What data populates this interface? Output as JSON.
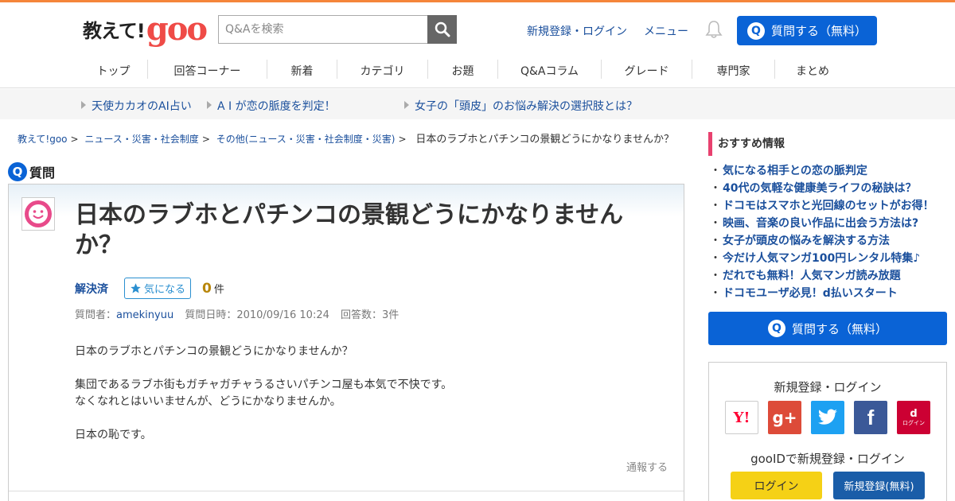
{
  "header": {
    "logo_text": "教えて!",
    "logo_brand": "goo",
    "search_placeholder": "Q&Aを検索",
    "register_login": "新規登録・ログイン",
    "menu": "メニュー",
    "ask_button": "質問する（無料）"
  },
  "nav": [
    "トップ",
    "回答コーナー",
    "新着",
    "カテゴリ",
    "お題",
    "Q&Aコラム",
    "グレード",
    "専門家",
    "まとめ"
  ],
  "promo": [
    "天使カカオのAI占い",
    "A I が恋の脈度を判定！",
    "女子の「頭皮」のお悩み解決の選択肢とは？"
  ],
  "breadcrumb": {
    "items": [
      "教えて!goo",
      "ニュース・災害・社会制度",
      "その他(ニュース・災害・社会制度・災害)"
    ],
    "separator": ">",
    "current": "日本のラブホとパチンコの景観どうにかなりませんか？"
  },
  "question": {
    "section_label": "質問",
    "title": "日本のラブホとパチンコの景観どうにかなりませんか？",
    "status": "解決済",
    "fav_label": "気になる",
    "fav_count": "0",
    "fav_unit": "件",
    "meta_asker_label": "質問者：",
    "asker": "amekinyuu",
    "meta_date": "質問日時：2010/09/16 10:24",
    "meta_answers": "回答数：3件",
    "body": [
      "日本のラブホとパチンコの景観どうにかなりませんか？",
      "集団であるラブホ街もガチャガチャうるさいパチンコ屋も本気で不快です。",
      "なくなれとはいいませんが、どうにかなりませんか。",
      "日本の恥です。"
    ],
    "report": "通報する"
  },
  "sidebar": {
    "recommend_title": "おすすめ情報",
    "bullet": "・",
    "links": [
      "気になる相手との恋の脈判定",
      "40代の気軽な健康美ライフの秘訣は？",
      "ドコモはスマホと光回線のセットがお得！",
      "映画、音楽の良い作品に出会う方法は?",
      "女子が頭皮の悩みを解決する方法",
      "今だけ人気マンガ100円レンタル特集♪",
      "だれでも無料！人気マンガ読み放題",
      "ドコモユーザ必見！d払いスタート"
    ],
    "ask_button": "質問する（無料）",
    "login_title": "新規登録・ログイン",
    "sns": [
      {
        "name": "yahoo",
        "label": "Y!",
        "color": "#ffffff"
      },
      {
        "name": "google-plus",
        "label": "g+",
        "color": "#dd4b39"
      },
      {
        "name": "twitter",
        "label": "t",
        "color": "#1da1f2"
      },
      {
        "name": "facebook",
        "label": "f",
        "color": "#3b5998"
      },
      {
        "name": "docomo",
        "label": "d",
        "sublabel": "ログイン",
        "color": "#cc0033"
      }
    ],
    "gooid_text": "gooIDで新規登録・ログイン",
    "login_button": "ログイン",
    "register_button": "新規登録(無料)"
  },
  "colors": {
    "accent_orange": "#f5853a",
    "primary_blue": "#0a63d6",
    "link_blue": "#1a4f9c",
    "pink": "#e8416f"
  }
}
